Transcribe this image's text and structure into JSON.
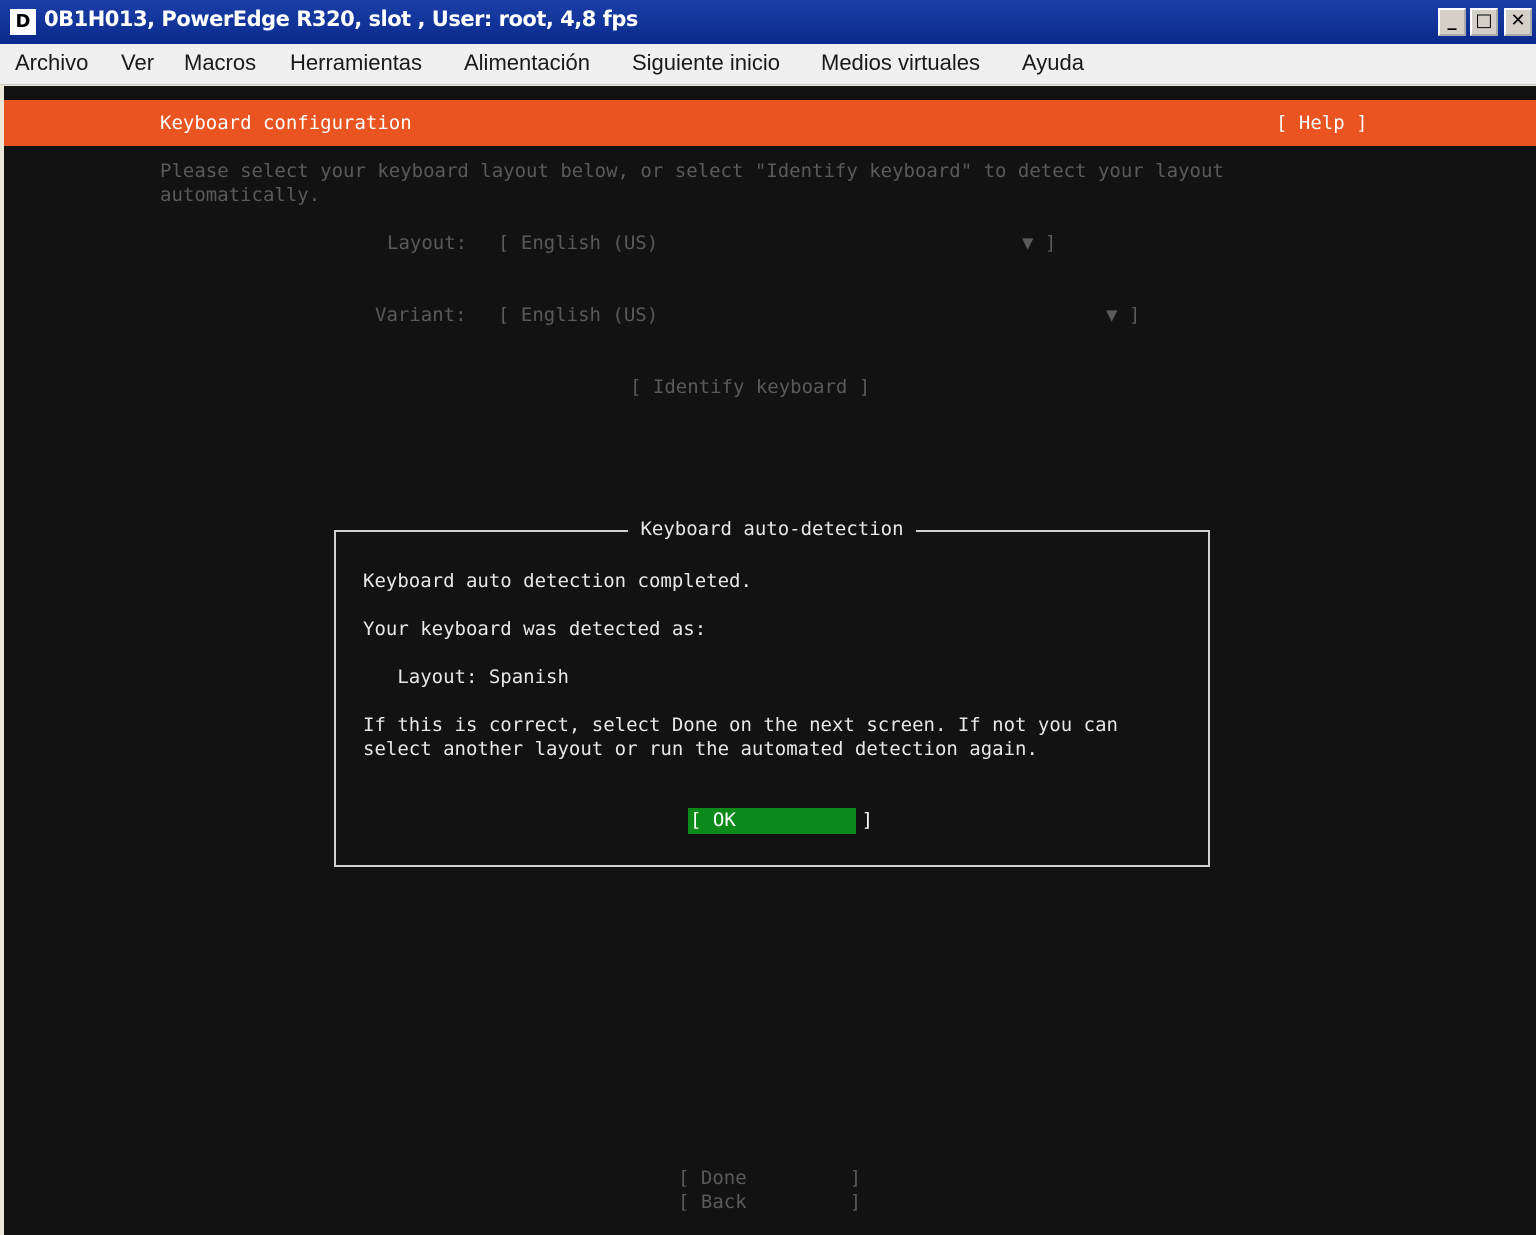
{
  "titlebar": {
    "icon_letter": "D",
    "title": "0B1H013, PowerEdge R320,  slot , User: root, 4,8 fps",
    "minimize": "_",
    "maximize": "□",
    "close": "✕"
  },
  "menubar": {
    "items": [
      "Archivo",
      "Ver",
      "Macros",
      "Herramientas",
      "Alimentación",
      "Siguiente inicio",
      "Medios virtuales",
      "Ayuda"
    ]
  },
  "installer": {
    "header_title": "Keyboard configuration",
    "help": "[ Help ]",
    "instructions_line1": "Please select your keyboard layout below, or select \"Identify keyboard\" to detect your layout",
    "instructions_line2": "automatically.",
    "layout_label": "Layout:",
    "layout_value": "[ English (US)",
    "layout_arrow": "▼ ]",
    "variant_label": "Variant:",
    "variant_value": "[ English (US)",
    "variant_arrow": "▼ ]",
    "identify_button": "[ Identify keyboard ]",
    "done_button": "[ Done         ]",
    "back_button": "[ Back         ]"
  },
  "dialog": {
    "title": "Keyboard auto-detection",
    "line1": "Keyboard auto detection completed.",
    "line2": "Your keyboard was detected as:",
    "detected_layout": "   Layout: Spanish",
    "line4a": "If this is correct, select Done on the next screen. If not you can",
    "line4b": "select another layout or run the automated detection again.",
    "ok_button": "[ OK           ]"
  }
}
